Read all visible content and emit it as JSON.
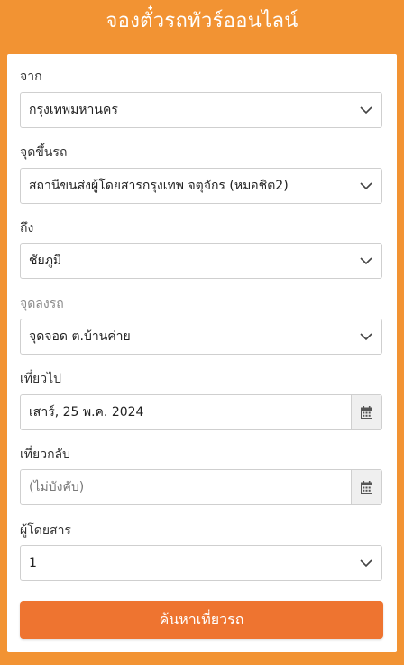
{
  "header": {
    "title": "จองตั๋วรถทัวร์ออนไลน์"
  },
  "form": {
    "from": {
      "label": "จาก",
      "value": "กรุงเทพมหานคร"
    },
    "pickup": {
      "label": "จุดขึ้นรถ",
      "value": "สถานีขนส่งผู้โดยสารกรุงเทพ จตุจักร (หมอชิต2)"
    },
    "to": {
      "label": "ถึง",
      "value": "ชัยภูมิ"
    },
    "dropoff": {
      "label": "จุดลงรถ",
      "value": "จุดจอด ต.บ้านค่าย"
    },
    "depart": {
      "label": "เที่ยวไป",
      "value": "เสาร์, 25 พ.ค. 2024"
    },
    "return": {
      "label": "เที่ยวกลับ",
      "placeholder": "(ไม่บังคับ)"
    },
    "passengers": {
      "label": "ผู้โดยสาร",
      "value": "1"
    },
    "submit_label": "ค้นหาเที่ยวรถ"
  },
  "colors": {
    "accent": "#ee7430",
    "background": "#f29333"
  },
  "icons": {
    "select": "chevron-down-icon",
    "date": "calendar-icon"
  }
}
